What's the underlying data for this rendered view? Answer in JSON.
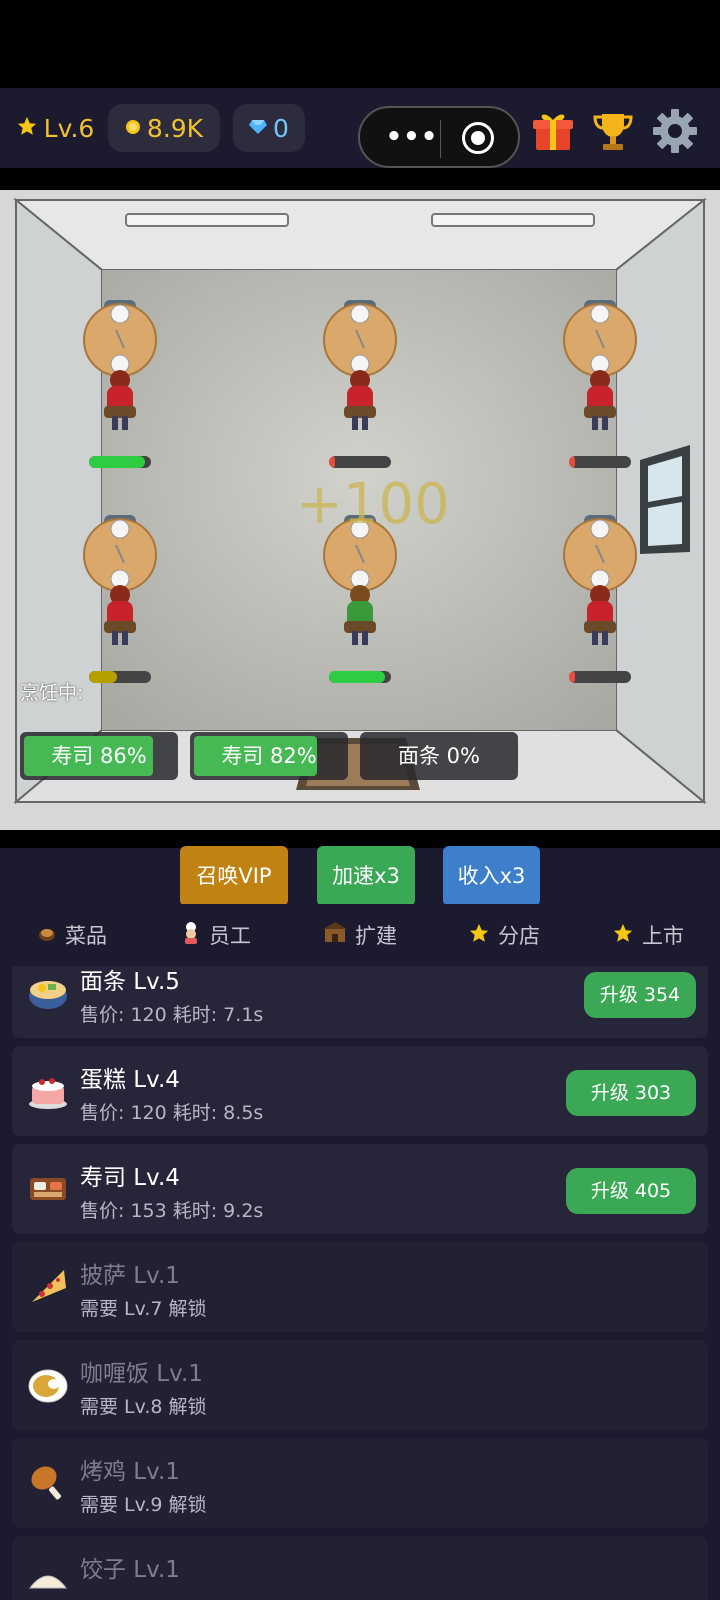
{
  "header": {
    "level": "Lv.6",
    "coins": "8.9K",
    "gems": "0",
    "icons": [
      "star-icon",
      "coin-icon",
      "diamond-icon",
      "more-dots-icon",
      "close-target-icon",
      "gift-icon",
      "trophy-icon",
      "gear-icon"
    ]
  },
  "scene": {
    "tables": [
      {
        "progress": 0.9,
        "color": "#2ecc40"
      },
      {
        "progress": 0.1,
        "color": "#e74c3c"
      },
      {
        "progress": 0.1,
        "color": "#e74c3c"
      },
      {
        "progress": 0.45,
        "color": "#b5a000"
      },
      {
        "progress": 0.9,
        "color": "#2ecc40"
      },
      {
        "progress": 0.1,
        "color": "#e74c3c"
      }
    ],
    "income_float": "+100",
    "cooking_label": "烹饪中:",
    "cooking_slots": [
      {
        "label": "寿司 86%",
        "progress": 0.86
      },
      {
        "label": "寿司 82%",
        "progress": 0.82
      },
      {
        "label": "面条 0%",
        "progress": 0
      }
    ]
  },
  "actions": {
    "vip": "召唤VIP",
    "speed": "加速x3",
    "income": "收入x3",
    "colors": {
      "vip": "#c08313",
      "speed": "#3aa855",
      "income": "#3d7fca"
    }
  },
  "tabs": [
    {
      "label": "菜品",
      "icon": "dish-icon",
      "active": true
    },
    {
      "label": "员工",
      "icon": "chef-icon",
      "active": false
    },
    {
      "label": "扩建",
      "icon": "building-icon",
      "active": false
    },
    {
      "label": "分店",
      "icon": "star-icon",
      "active": false
    },
    {
      "label": "上市",
      "icon": "star-icon",
      "active": false
    }
  ],
  "dishes": [
    {
      "name": "面条 Lv.5",
      "sub": "售价: 120   耗时: 7.1s",
      "button": "升级 354",
      "icon": "noodle-bowl-icon",
      "locked": false
    },
    {
      "name": "蛋糕 Lv.4",
      "sub": "售价: 120   耗时: 8.5s",
      "button": "升级 303",
      "icon": "cake-icon",
      "locked": false
    },
    {
      "name": "寿司 Lv.4",
      "sub": "售价: 153   耗时: 9.2s",
      "button": "升级 405",
      "icon": "sushi-icon",
      "locked": false
    },
    {
      "name": "披萨 Lv.1",
      "sub": "需要 Lv.7 解锁",
      "icon": "pizza-icon",
      "locked": true
    },
    {
      "name": "咖喱饭 Lv.1",
      "sub": "需要 Lv.8 解锁",
      "icon": "curry-icon",
      "locked": true
    },
    {
      "name": "烤鸡 Lv.1",
      "sub": "需要 Lv.9 解锁",
      "icon": "chicken-leg-icon",
      "locked": true
    },
    {
      "name": "饺子 Lv.1",
      "sub": "",
      "icon": "dumpling-icon",
      "locked": true
    }
  ]
}
